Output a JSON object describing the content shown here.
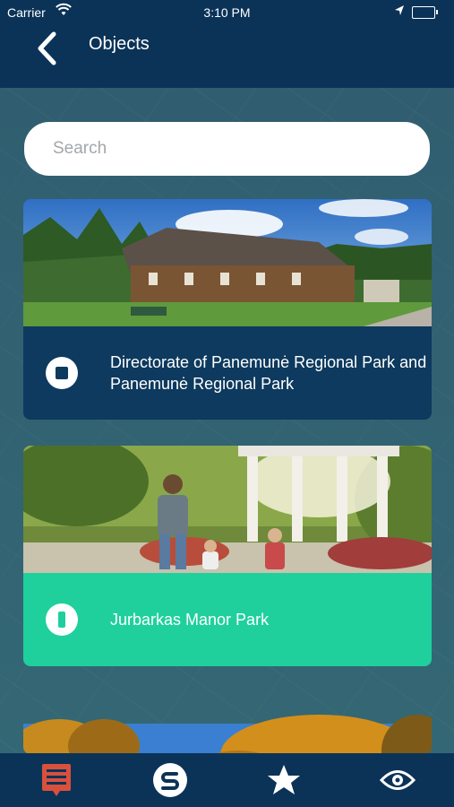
{
  "status_bar": {
    "carrier": "Carrier",
    "time": "3:10 PM",
    "wifi_icon": "wifi-icon",
    "location_icon": "location-arrow-icon",
    "battery_icon": "battery-icon",
    "battery_color": "#2ecc71"
  },
  "nav": {
    "title": "Objects",
    "back_icon": "chevron-left-icon"
  },
  "search": {
    "placeholder": "Search",
    "value": ""
  },
  "objects": [
    {
      "title": "Directorate of Panemunė Regional Park and Panemunė Regional Park",
      "badge_icon": "stop-square-icon",
      "footer_color": "#0d3a5e",
      "image": "wooden-manor-house-photo"
    },
    {
      "title": "Jurbarkas Manor Park",
      "badge_icon": "pause-bar-icon",
      "footer_color": "#1fd09d",
      "image": "park-family-walk-photo"
    },
    {
      "title": "",
      "image": "autumn-trees-photo"
    }
  ],
  "tab_bar": {
    "items": [
      {
        "icon": "list-icon",
        "color": "#d9503c",
        "active": true
      },
      {
        "icon": "s-logo-icon",
        "color": "#ffffff",
        "active": false
      },
      {
        "icon": "star-icon",
        "color": "#ffffff",
        "active": false
      },
      {
        "icon": "eye-icon",
        "color": "#ffffff",
        "active": false
      }
    ]
  },
  "colors": {
    "header": "#0b3358",
    "accent_green": "#1fd09d",
    "accent_red": "#d9503c"
  }
}
